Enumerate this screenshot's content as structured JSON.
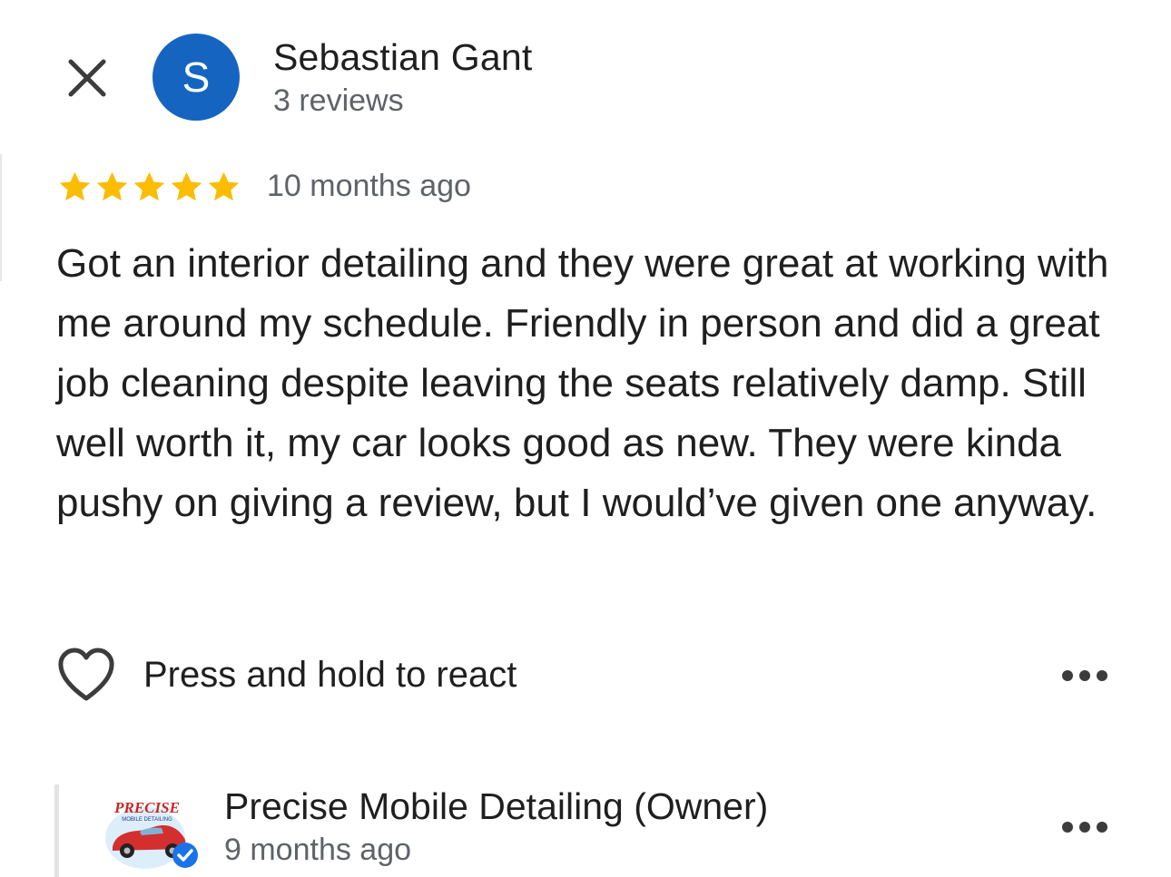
{
  "header": {
    "close_icon": "close-icon",
    "avatar_letter": "S",
    "avatar_color": "#1565c0",
    "reviewer_name": "Sebastian Gant",
    "reviewer_meta": "3 reviews"
  },
  "review": {
    "rating": 5,
    "rating_max": 5,
    "star_color": "#fbbc04",
    "date": "10 months ago",
    "text": "Got an interior detailing and they were great at working with me around my schedule. Friendly in person and did a great job cleaning despite leaving the seats relatively damp. Still well worth it, my car looks good as new. They were kinda pushy on giving a review, but I would’ve given one anyway."
  },
  "actions": {
    "react_label": "Press and hold to react",
    "react_icon": "heart-icon",
    "more_icon": "more-horizontal-icon"
  },
  "owner_reply": {
    "logo_text": "PRECISE",
    "logo_subtext": "MOBILE DETAILING",
    "name": "Precise Mobile Detailing (Owner)",
    "date": "9 months ago",
    "verified_icon": "verified-badge-icon",
    "verified_color": "#1a73e8"
  }
}
